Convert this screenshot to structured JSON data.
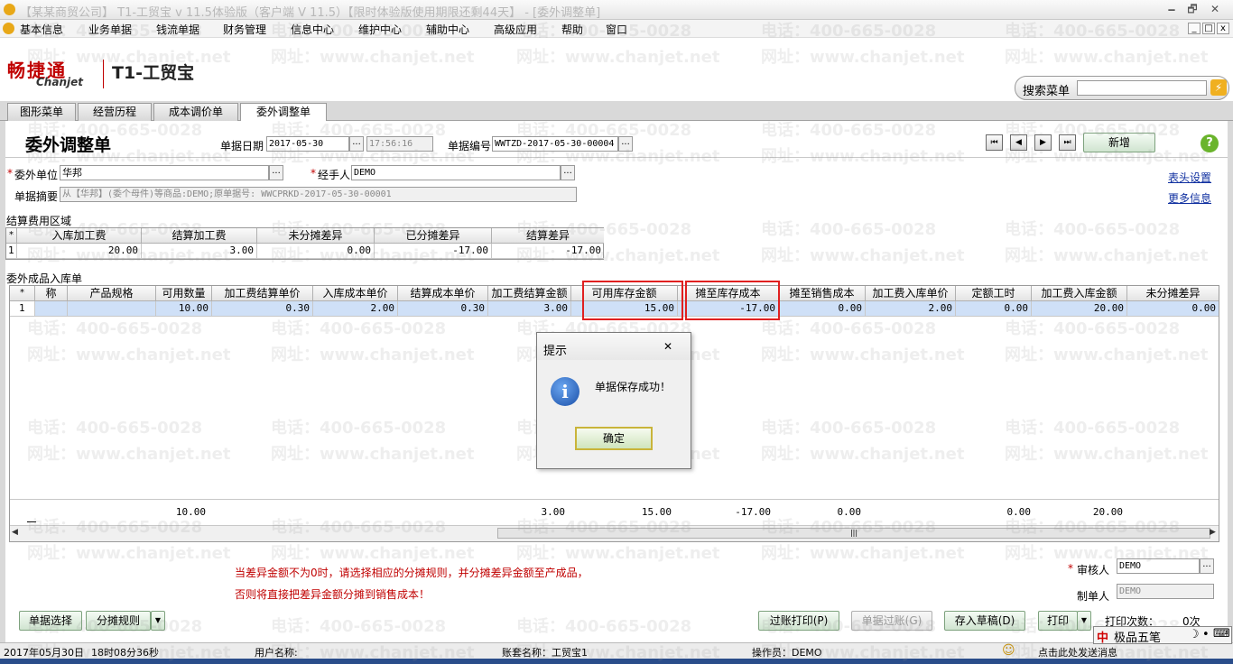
{
  "window": {
    "title": "【某某商贸公司】 T1-工贸宝 v 11.5体验版（客户端 V 11.5）【限时体验版使用期限还剩44天】 - [委外调整单]",
    "minimize_glyph": "🗕",
    "restore_glyph": "🗗",
    "close_glyph": "✕",
    "mdi_min": "_",
    "mdi_restore": "□",
    "mdi_close": "x"
  },
  "menu": [
    "基本信息",
    "业务单据",
    "钱流单据",
    "财务管理",
    "信息中心",
    "维护中心",
    "辅助中心",
    "高级应用",
    "帮助",
    "窗口"
  ],
  "brand": {
    "logo_cn": "畅捷通",
    "logo_en": "Chanjet",
    "product": "T1-工贸宝"
  },
  "search": {
    "label": "搜索菜单",
    "value": "",
    "go_glyph": "⚡"
  },
  "tabs": [
    {
      "label": "图形菜单",
      "active": false
    },
    {
      "label": "经营历程",
      "active": false
    },
    {
      "label": "成本调价单",
      "active": false
    },
    {
      "label": "委外调整单",
      "active": true
    }
  ],
  "form": {
    "title": "委外调整单",
    "date_label": "单据日期",
    "date_value": "2017-05-30",
    "time_value": "17:56:16",
    "number_label": "单据编号",
    "number_value": "WWTZD-2017-05-30-00004",
    "vendor_label": "委外单位",
    "vendor_value": "华邦",
    "handler_label": "经手人",
    "handler_value": "DEMO",
    "summary_label": "单据摘要",
    "summary_value": "从【华邦】(委个母件)等商品:DEMO;原单据号: WWCPRKD-2017-05-30-00001",
    "required_mark": "*",
    "ellipsis": "..."
  },
  "nav": {
    "first": "⏮",
    "prev": "◀",
    "next": "▶",
    "last": "⏭",
    "new_label": "新增"
  },
  "help_glyph": "?",
  "links": {
    "header_settings": "表头设置",
    "more_info": "更多信息"
  },
  "settlement": {
    "section_label": "结算费用区域",
    "row_mark": "*",
    "columns": [
      "入库加工费",
      "结算加工费",
      "未分摊差异",
      "已分摊差异",
      "结算差异"
    ],
    "rows": [
      {
        "no": "1",
        "cells": [
          "20.00",
          "3.00",
          "0.00",
          "-17.00",
          "-17.00"
        ]
      }
    ]
  },
  "products": {
    "section_label": "委外成品入库单",
    "row_mark": "*",
    "columns": [
      "称",
      "产品规格",
      "可用数量",
      "加工费结算单价",
      "入库成本单价",
      "结算成本单价",
      "加工费结算金额",
      "可用库存金额",
      "摊至库存成本",
      "摊至销售成本",
      "加工费入库单价",
      "定额工时",
      "加工费入库金额",
      "未分摊差异"
    ],
    "rows": [
      {
        "no": "1",
        "cells": [
          "",
          "",
          "10.00",
          "0.30",
          "2.00",
          "0.30",
          "3.00",
          "15.00",
          "-17.00",
          "0.00",
          "2.00",
          "0.00",
          "20.00",
          "0.00"
        ]
      }
    ],
    "totals": [
      "10.00",
      "3.00",
      "15.00",
      "-17.00",
      "0.00",
      "0.00",
      "20.00"
    ],
    "scroll_left": "◀",
    "scroll_right": "▶",
    "scroll_grip": "|||"
  },
  "notes": [
    "当差异金额不为0时，请选择相应的分摊规则，并分摊差异金额至产成品，",
    "否则将直接把差异金额分摊到销售成本！"
  ],
  "approval": {
    "reviewer_label": "审核人",
    "reviewer_value": "DEMO",
    "creator_label": "制单人",
    "creator_value": "DEMO"
  },
  "buttons": {
    "select_doc": "单据选择",
    "alloc_rule": "分摊规则",
    "dropdown": "▼",
    "post_print": "过账打印(P)",
    "post": "单据过账(G)",
    "save_draft": "存入草稿(D)",
    "print": "打印",
    "print_count_label": "打印次数：",
    "print_count_value": "0次"
  },
  "dialog": {
    "title": "提示",
    "close_glyph": "✕",
    "icon_glyph": "i",
    "message": "单据保存成功！",
    "ok_label": "确定"
  },
  "status": {
    "date": "2017年05月30日",
    "time": "18时08分36秒",
    "user_label": "用户名称:",
    "account_label": "账套名称：工贸宝1",
    "operator_label": "操作员：DEMO",
    "smile_glyph": "☺",
    "message": "点击此处发送消息"
  },
  "ime": {
    "zh": "中",
    "name": "极品五笔",
    "moon": "☽",
    "dot": "•",
    "keyboard": "⌨"
  },
  "watermarks": {
    "phone": "电话：400-665-0028",
    "site": "网址：www.chanjet.net"
  }
}
